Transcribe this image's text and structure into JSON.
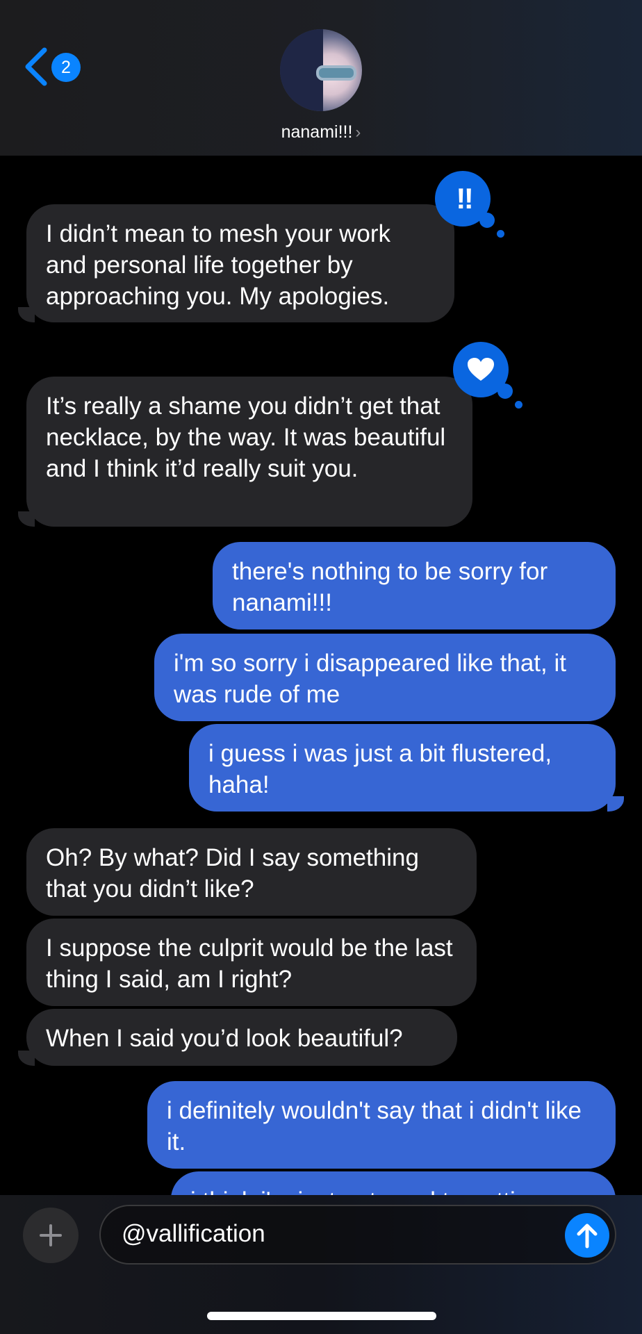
{
  "header": {
    "back_badge": "2",
    "contact_name": "nanami!!!",
    "name_chevron": "›"
  },
  "tapbacks": {
    "first": {
      "icon": "exclamation-icon",
      "text": "‼"
    },
    "second": {
      "icon": "heart-icon"
    }
  },
  "messages": [
    {
      "from": "them",
      "text": "I didn’t mean to mesh your work and personal life together by approaching you. My apologies."
    },
    {
      "from": "them",
      "text": "It’s really a shame you didn’t get that necklace, by the way. It was beautiful and I think it’d really suit you."
    },
    {
      "from": "me",
      "text": "there's nothing to be sorry for nanami!!!"
    },
    {
      "from": "me",
      "text": "i'm so sorry i disappeared like that, it was rude of me"
    },
    {
      "from": "me",
      "text": "i guess i was just a bit flustered, haha!"
    },
    {
      "from": "them",
      "text": "Oh? By what? Did I say something that you didn’t like?"
    },
    {
      "from": "them",
      "text": "I suppose the culprit would be the last thing I said, am I right?"
    },
    {
      "from": "them",
      "text": "When I said you’d look beautiful?"
    },
    {
      "from": "me",
      "text": "i definitely wouldn't say that i didn't like it."
    },
    {
      "from": "me",
      "text": "i think i'm just not used to getting"
    }
  ],
  "composer": {
    "text": "@vallification"
  },
  "colors": {
    "incoming_bubble": "#262629",
    "outgoing_bubble": "#3766d4",
    "accent": "#0a84ff"
  }
}
